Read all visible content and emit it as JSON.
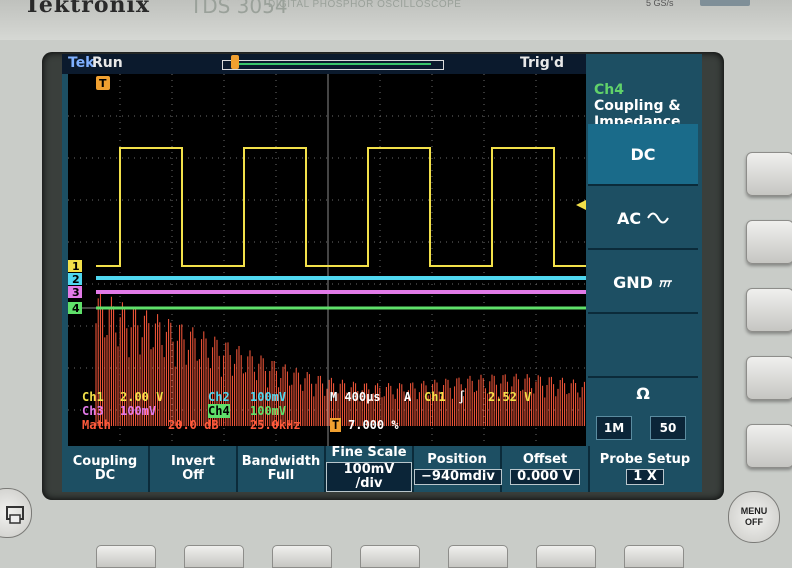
{
  "instrument": {
    "brand": "Tektronix",
    "model": "TDS 3054",
    "model_desc": "DIGITAL PHOSPHOR OSCILLOSCOPE",
    "sample_rate": "5 GS/s"
  },
  "status": {
    "logo": "Tek",
    "run_state": "Run",
    "trigger_state": "Trig'd",
    "trigger_marker": "T"
  },
  "channels": {
    "markers": [
      "1",
      "2",
      "3",
      "4"
    ],
    "colors": {
      "ch1": "#f2e04a",
      "ch2": "#4fd7f0",
      "ch3": "#e27ae8",
      "ch4": "#5fe06a",
      "math": "#ff5a3c"
    }
  },
  "readout": {
    "ch1_label": "Ch1",
    "ch1_scale": "2.00 V",
    "ch2_label": "Ch2",
    "ch2_scale": "100mV",
    "timebase": "M 400µs",
    "trig_mode": "A",
    "trig_source": "Ch1",
    "trig_slope": "∫",
    "trig_level": "2.52 V",
    "ch3_label": "Ch3",
    "ch3_scale": "100mV",
    "ch4_label": "Ch4",
    "ch4_scale": "100mV",
    "math_label": "Math",
    "math_scale": "20.0 dB",
    "math_freq": "25.0kHz",
    "trigger_pos_marker": "T",
    "trigger_pos": "7.000 %"
  },
  "side_menu": {
    "channel": "Ch4",
    "title_rest": "Coupling & Impedance",
    "dc_label": "DC",
    "ac_label": "AC",
    "gnd_label": "GND",
    "ohm_label": "Ω",
    "imp_1m": "1M",
    "imp_50": "50"
  },
  "bottom_menu": [
    {
      "label": "Coupling",
      "value": "DC"
    },
    {
      "label": "Invert",
      "value": "Off"
    },
    {
      "label": "Bandwidth",
      "value": "Full"
    },
    {
      "label": "Fine Scale",
      "value": "100mV /div"
    },
    {
      "label": "Position",
      "value": "−940mdiv"
    },
    {
      "label": "Offset",
      "value": "0.000 V"
    },
    {
      "label": "Probe Setup",
      "value": "1 X"
    }
  ],
  "hardware": {
    "menu_off_line1": "MENU",
    "menu_off_line2": "OFF"
  }
}
